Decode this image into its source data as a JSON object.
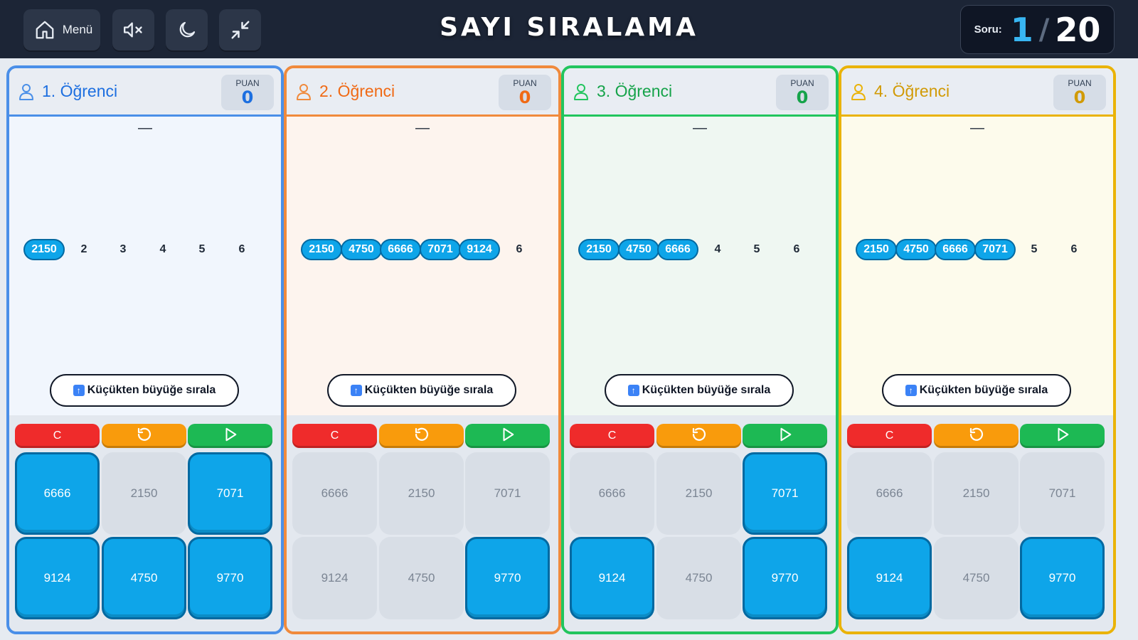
{
  "topbar": {
    "menu_label": "Menü",
    "title": "SAYI SIRALAMA",
    "question_label": "Soru:",
    "question_current": "1",
    "question_separator": "/",
    "question_total": "20"
  },
  "common": {
    "score_label": "PUAN",
    "placeholder_dash": "—",
    "order_button_label": "Küçükten büyüğe sırala",
    "clear_label": "C"
  },
  "colors": {
    "blue": "#3b82f6",
    "orange": "#f08a3c",
    "green": "#22c55e",
    "yellow": "#eab308"
  },
  "players": [
    {
      "name": "1. Öğrenci",
      "score": "0",
      "accent": "#4a8fe8",
      "score_color": "#1d6fe0",
      "body_bg": "#f1f6fd",
      "slots": [
        {
          "text": "2150",
          "filled": true
        },
        {
          "text": "2",
          "filled": false
        },
        {
          "text": "3",
          "filled": false
        },
        {
          "text": "4",
          "filled": false
        },
        {
          "text": "5",
          "filled": false
        },
        {
          "text": "6",
          "filled": false
        }
      ],
      "keys": [
        {
          "value": "6666",
          "active": true
        },
        {
          "value": "2150",
          "active": false
        },
        {
          "value": "7071",
          "active": true
        },
        {
          "value": "9124",
          "active": true
        },
        {
          "value": "4750",
          "active": true
        },
        {
          "value": "9770",
          "active": true
        }
      ]
    },
    {
      "name": "2. Öğrenci",
      "score": "0",
      "accent": "#f08a3c",
      "score_color": "#f06a15",
      "body_bg": "#fdf4ee",
      "slots": [
        {
          "text": "2150",
          "filled": true
        },
        {
          "text": "4750",
          "filled": true
        },
        {
          "text": "6666",
          "filled": true
        },
        {
          "text": "7071",
          "filled": true
        },
        {
          "text": "9124",
          "filled": true
        },
        {
          "text": "6",
          "filled": false
        }
      ],
      "keys": [
        {
          "value": "6666",
          "active": false
        },
        {
          "value": "2150",
          "active": false
        },
        {
          "value": "7071",
          "active": false
        },
        {
          "value": "9124",
          "active": false
        },
        {
          "value": "4750",
          "active": false
        },
        {
          "value": "9770",
          "active": true
        }
      ]
    },
    {
      "name": "3. Öğrenci",
      "score": "0",
      "accent": "#22c55e",
      "score_color": "#16a34a",
      "body_bg": "#eff7f2",
      "slots": [
        {
          "text": "2150",
          "filled": true
        },
        {
          "text": "4750",
          "filled": true
        },
        {
          "text": "6666",
          "filled": true
        },
        {
          "text": "4",
          "filled": false
        },
        {
          "text": "5",
          "filled": false
        },
        {
          "text": "6",
          "filled": false
        }
      ],
      "keys": [
        {
          "value": "6666",
          "active": false
        },
        {
          "value": "2150",
          "active": false
        },
        {
          "value": "7071",
          "active": true
        },
        {
          "value": "9124",
          "active": true
        },
        {
          "value": "4750",
          "active": false
        },
        {
          "value": "9770",
          "active": true
        }
      ]
    },
    {
      "name": "4. Öğrenci",
      "score": "0",
      "accent": "#eab308",
      "score_color": "#d19a06",
      "body_bg": "#fdfbec",
      "slots": [
        {
          "text": "2150",
          "filled": true
        },
        {
          "text": "4750",
          "filled": true
        },
        {
          "text": "6666",
          "filled": true
        },
        {
          "text": "7071",
          "filled": true
        },
        {
          "text": "5",
          "filled": false
        },
        {
          "text": "6",
          "filled": false
        }
      ],
      "keys": [
        {
          "value": "6666",
          "active": false
        },
        {
          "value": "2150",
          "active": false
        },
        {
          "value": "7071",
          "active": false
        },
        {
          "value": "9124",
          "active": true
        },
        {
          "value": "4750",
          "active": false
        },
        {
          "value": "9770",
          "active": true
        }
      ]
    }
  ]
}
